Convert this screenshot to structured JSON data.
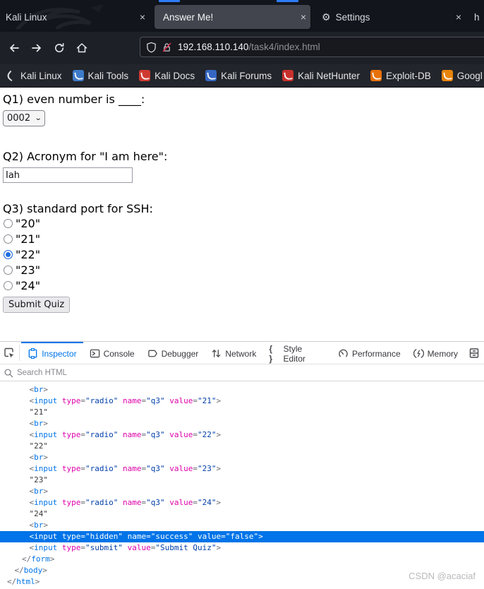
{
  "colors": {
    "accent_blue": "#2e7cf6",
    "devtools_accent": "#0074e8",
    "selected_row": "#0074e8",
    "attr_name": "#dd00a9",
    "attr_value": "#003eaa"
  },
  "browser": {
    "tabs": [
      {
        "label": "Kali Linux",
        "close": "×"
      },
      {
        "label": "Answer Me!",
        "close": "×"
      },
      {
        "label": "Settings",
        "close": "×"
      },
      {
        "label": "h"
      }
    ],
    "nav": {
      "url_host": "192.168.110.140",
      "url_path": "/task4/index.html"
    },
    "bookmarks": [
      {
        "label": "Kali Linux",
        "icon": "kali-dragon-icon",
        "color": "transparent"
      },
      {
        "label": "Kali Tools",
        "icon": "kali-tools-icon",
        "color": "#3d7bc9"
      },
      {
        "label": "Kali Docs",
        "icon": "kali-docs-icon",
        "color": "#cf3a30"
      },
      {
        "label": "Kali Forums",
        "icon": "kali-forums-icon",
        "color": "#3566c2"
      },
      {
        "label": "Kali NetHunter",
        "icon": "kali-nethunter-icon",
        "color": "#c9302c"
      },
      {
        "label": "Exploit-DB",
        "icon": "exploit-db-icon",
        "color": "#e8710a"
      },
      {
        "label": "Googl",
        "icon": "google-hacking-icon",
        "color": "#e8840a"
      }
    ]
  },
  "page": {
    "q1_label": "Q1) even number is ____:",
    "q1_value": "0002",
    "q2_label": "Q2) Acronym for \"I am here\":",
    "q2_value": "Iah",
    "q3_label": "Q3) standard port for SSH:",
    "q3_options": [
      {
        "label": "\"20\"",
        "checked": false
      },
      {
        "label": "\"21\"",
        "checked": false
      },
      {
        "label": "\"22\"",
        "checked": true
      },
      {
        "label": "\"23\"",
        "checked": false
      },
      {
        "label": "\"24\"",
        "checked": false
      }
    ],
    "submit_label": "Submit Quiz"
  },
  "devtools": {
    "tabs": [
      "Inspector",
      "Console",
      "Debugger",
      "Network",
      "Style Editor",
      "Performance",
      "Memory"
    ],
    "active_tab": "Inspector",
    "search_placeholder": "Search HTML",
    "markup_lines": [
      {
        "ind": 3,
        "sel": false,
        "tok": [
          [
            "p",
            "<"
          ],
          [
            "t",
            "br"
          ],
          [
            "p",
            ">"
          ]
        ]
      },
      {
        "ind": 3,
        "sel": false,
        "tok": [
          [
            "p",
            "<"
          ],
          [
            "t",
            "input"
          ],
          [
            "a",
            " type"
          ],
          [
            "p",
            "="
          ],
          [
            "v",
            "\"radio\""
          ],
          [
            "a",
            " name"
          ],
          [
            "p",
            "="
          ],
          [
            "v",
            "\"q3\""
          ],
          [
            "a",
            " value"
          ],
          [
            "p",
            "="
          ],
          [
            "v",
            "\"21\""
          ],
          [
            "p",
            ">"
          ]
        ]
      },
      {
        "ind": 3,
        "sel": false,
        "tok": [
          [
            "x",
            "\"21\""
          ]
        ]
      },
      {
        "ind": 3,
        "sel": false,
        "tok": [
          [
            "p",
            "<"
          ],
          [
            "t",
            "br"
          ],
          [
            "p",
            ">"
          ]
        ]
      },
      {
        "ind": 3,
        "sel": false,
        "tok": [
          [
            "p",
            "<"
          ],
          [
            "t",
            "input"
          ],
          [
            "a",
            " type"
          ],
          [
            "p",
            "="
          ],
          [
            "v",
            "\"radio\""
          ],
          [
            "a",
            " name"
          ],
          [
            "p",
            "="
          ],
          [
            "v",
            "\"q3\""
          ],
          [
            "a",
            " value"
          ],
          [
            "p",
            "="
          ],
          [
            "v",
            "\"22\""
          ],
          [
            "p",
            ">"
          ]
        ]
      },
      {
        "ind": 3,
        "sel": false,
        "tok": [
          [
            "x",
            "\"22\""
          ]
        ]
      },
      {
        "ind": 3,
        "sel": false,
        "tok": [
          [
            "p",
            "<"
          ],
          [
            "t",
            "br"
          ],
          [
            "p",
            ">"
          ]
        ]
      },
      {
        "ind": 3,
        "sel": false,
        "tok": [
          [
            "p",
            "<"
          ],
          [
            "t",
            "input"
          ],
          [
            "a",
            " type"
          ],
          [
            "p",
            "="
          ],
          [
            "v",
            "\"radio\""
          ],
          [
            "a",
            " name"
          ],
          [
            "p",
            "="
          ],
          [
            "v",
            "\"q3\""
          ],
          [
            "a",
            " value"
          ],
          [
            "p",
            "="
          ],
          [
            "v",
            "\"23\""
          ],
          [
            "p",
            ">"
          ]
        ]
      },
      {
        "ind": 3,
        "sel": false,
        "tok": [
          [
            "x",
            "\"23\""
          ]
        ]
      },
      {
        "ind": 3,
        "sel": false,
        "tok": [
          [
            "p",
            "<"
          ],
          [
            "t",
            "br"
          ],
          [
            "p",
            ">"
          ]
        ]
      },
      {
        "ind": 3,
        "sel": false,
        "tok": [
          [
            "p",
            "<"
          ],
          [
            "t",
            "input"
          ],
          [
            "a",
            " type"
          ],
          [
            "p",
            "="
          ],
          [
            "v",
            "\"radio\""
          ],
          [
            "a",
            " name"
          ],
          [
            "p",
            "="
          ],
          [
            "v",
            "\"q3\""
          ],
          [
            "a",
            " value"
          ],
          [
            "p",
            "="
          ],
          [
            "v",
            "\"24\""
          ],
          [
            "p",
            ">"
          ]
        ]
      },
      {
        "ind": 3,
        "sel": false,
        "tok": [
          [
            "x",
            "\"24\""
          ]
        ]
      },
      {
        "ind": 3,
        "sel": false,
        "tok": [
          [
            "p",
            "<"
          ],
          [
            "t",
            "br"
          ],
          [
            "p",
            ">"
          ]
        ]
      },
      {
        "ind": 3,
        "sel": true,
        "tok": [
          [
            "p",
            "<"
          ],
          [
            "t",
            "input"
          ],
          [
            "a",
            " type"
          ],
          [
            "p",
            "="
          ],
          [
            "v",
            "\"hidden\""
          ],
          [
            "a",
            " name"
          ],
          [
            "p",
            "="
          ],
          [
            "v",
            "\"success\""
          ],
          [
            "a",
            " value"
          ],
          [
            "p",
            "="
          ],
          [
            "v",
            "\"false\""
          ],
          [
            "p",
            ">"
          ]
        ]
      },
      {
        "ind": 3,
        "sel": false,
        "tok": [
          [
            "p",
            "<"
          ],
          [
            "t",
            "input"
          ],
          [
            "a",
            " type"
          ],
          [
            "p",
            "="
          ],
          [
            "v",
            "\"submit\""
          ],
          [
            "a",
            " value"
          ],
          [
            "p",
            "="
          ],
          [
            "v",
            "\"Submit Quiz\""
          ],
          [
            "p",
            ">"
          ]
        ]
      },
      {
        "ind": 2,
        "sel": false,
        "tok": [
          [
            "p",
            "</"
          ],
          [
            "t",
            "form"
          ],
          [
            "p",
            ">"
          ]
        ]
      },
      {
        "ind": 1,
        "sel": false,
        "tok": [
          [
            "p",
            "</"
          ],
          [
            "t",
            "body"
          ],
          [
            "p",
            ">"
          ]
        ]
      },
      {
        "ind": 0,
        "sel": false,
        "tok": [
          [
            "p",
            "</"
          ],
          [
            "t",
            "html"
          ],
          [
            "p",
            ">"
          ]
        ]
      }
    ]
  },
  "watermark": "CSDN @acaciaf"
}
